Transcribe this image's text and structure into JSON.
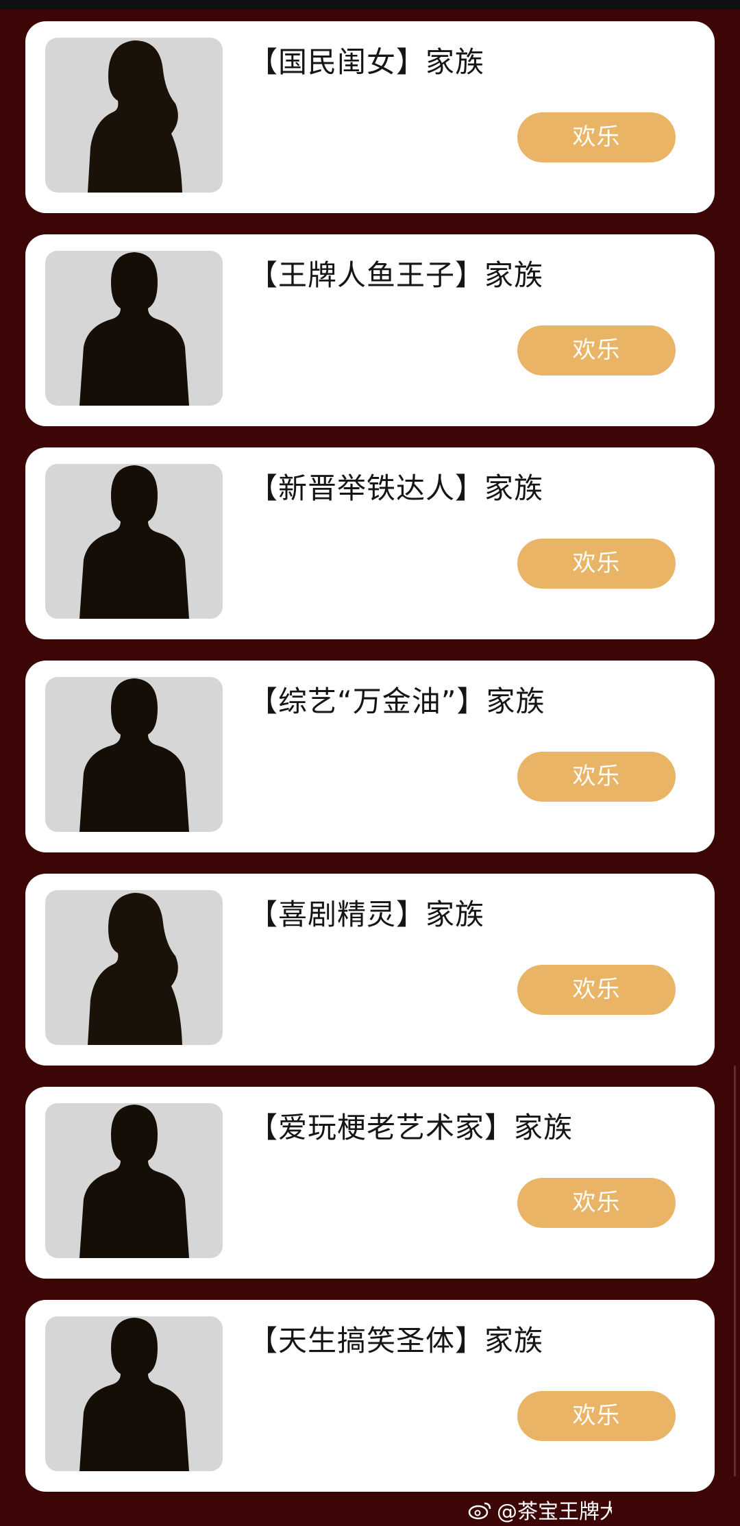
{
  "cards": [
    {
      "name": "【国民闺女】家族",
      "button": "欢乐",
      "avatar_icon": "female-silhouette-icon"
    },
    {
      "name": "【王牌人鱼王子】家族",
      "button": "欢乐",
      "avatar_icon": "male-silhouette-icon"
    },
    {
      "name": "【新晋举铁达人】家族",
      "button": "欢乐",
      "avatar_icon": "male-silhouette-icon"
    },
    {
      "name": "【综艺“万金油”】家族",
      "button": "欢乐",
      "avatar_icon": "male-silhouette-icon"
    },
    {
      "name": "【喜剧精灵】家族",
      "button": "欢乐",
      "avatar_icon": "female-silhouette-icon"
    },
    {
      "name": "【爱玩梗老艺术家】家族",
      "button": "欢乐",
      "avatar_icon": "male-silhouette-icon"
    },
    {
      "name": "【天生搞笑圣体】家族",
      "button": "欢乐",
      "avatar_icon": "male-silhouette-icon"
    }
  ],
  "watermark": {
    "text": "@茶宝王牌大",
    "icon": "weibo-logo-icon"
  },
  "colors": {
    "background": "#3d0606",
    "card": "#ffffff",
    "button": "#e9b466",
    "button_text": "#ffffff",
    "avatar_bg": "#d6d6d6"
  }
}
